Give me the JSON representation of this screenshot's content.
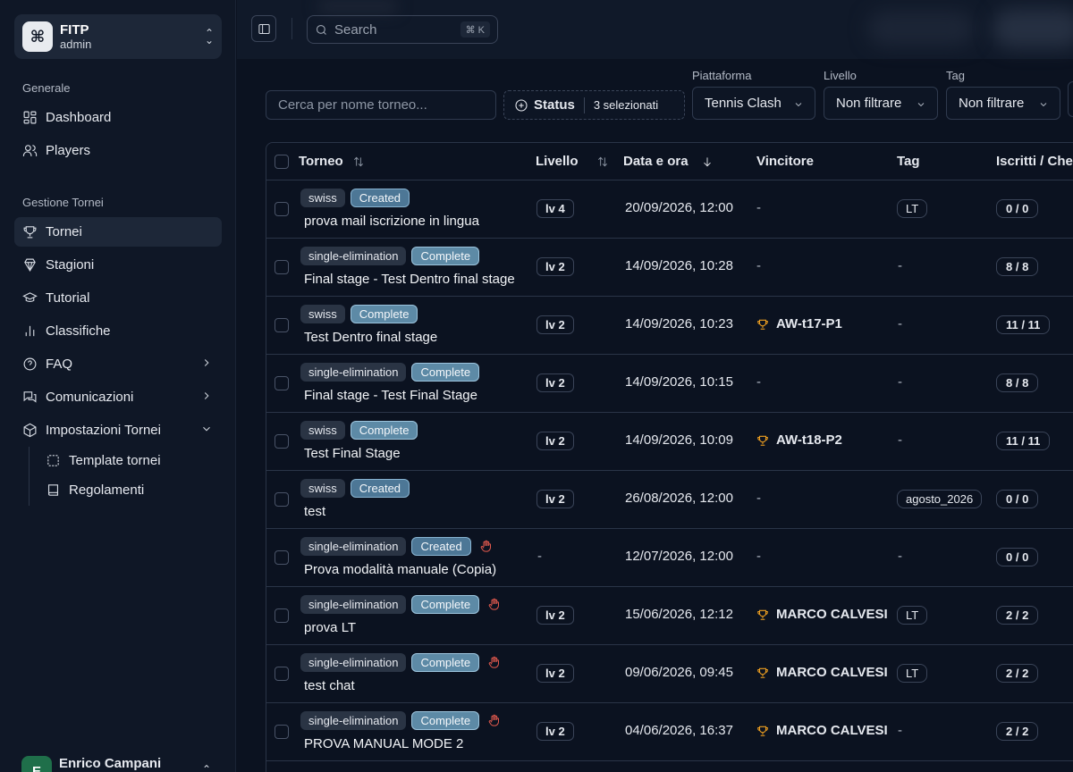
{
  "team": {
    "name": "FITP",
    "role": "admin",
    "logo_icon": "command-icon"
  },
  "sidebar": {
    "section_general": "Generale",
    "section_management": "Gestione Tornei",
    "items": [
      {
        "label": "Dashboard",
        "icon": "dashboard-icon"
      },
      {
        "label": "Players",
        "icon": "users-icon"
      },
      {
        "label": "Tornei",
        "icon": "trophy-icon",
        "active": true
      },
      {
        "label": "Stagioni",
        "icon": "award-icon"
      },
      {
        "label": "Tutorial",
        "icon": "graduation-cap-icon"
      },
      {
        "label": "Classifiche",
        "icon": "bar-chart-icon"
      },
      {
        "label": "FAQ",
        "icon": "help-circle-icon"
      },
      {
        "label": "Comunicazioni",
        "icon": "messages-icon"
      },
      {
        "label": "Impostazioni Tornei",
        "icon": "package-icon"
      }
    ],
    "subitems": [
      {
        "label": "Template tornei",
        "icon": "dashed-square-icon"
      },
      {
        "label": "Regolamenti",
        "icon": "book-icon"
      }
    ]
  },
  "user": {
    "initial": "E",
    "name": "Enrico Campani"
  },
  "topbar": {
    "search_placeholder": "Search",
    "search_shortcut": "⌘ K"
  },
  "filters": {
    "name_placeholder": "Cerca per nome torneo...",
    "status_label": "Status",
    "status_count": "3 selezionati",
    "platform_label": "Piattaforma",
    "platform_value": "Tennis Clash",
    "level_label": "Livello",
    "level_value": "Non filtrare",
    "tag_label": "Tag",
    "tag_value": "Non filtrare"
  },
  "table": {
    "columns": {
      "torneo": "Torneo",
      "livello": "Livello",
      "data": "Data e ora",
      "vincitore": "Vincitore",
      "tag": "Tag",
      "iscritti": "Iscritti / Check-in"
    },
    "rows": [
      {
        "type": "swiss",
        "status": "Created",
        "manual": false,
        "name": "prova mail iscrizione in lingua",
        "level": "lv 4",
        "date": "20/09/2026, 12:00",
        "winner": "-",
        "tag": "LT",
        "iscritti": "0 / 0"
      },
      {
        "type": "single-elimination",
        "status": "Complete",
        "manual": false,
        "name": "Final stage - Test Dentro final stage",
        "level": "lv 2",
        "date": "14/09/2026, 10:28",
        "winner": "-",
        "tag": "-",
        "iscritti": "8 / 8"
      },
      {
        "type": "swiss",
        "status": "Complete",
        "manual": false,
        "name": "Test Dentro final stage",
        "level": "lv 2",
        "date": "14/09/2026, 10:23",
        "winner": "AW-t17-P1",
        "tag": "-",
        "iscritti": "11 / 11"
      },
      {
        "type": "single-elimination",
        "status": "Complete",
        "manual": false,
        "name": "Final stage - Test Final Stage",
        "level": "lv 2",
        "date": "14/09/2026, 10:15",
        "winner": "-",
        "tag": "-",
        "iscritti": "8 / 8"
      },
      {
        "type": "swiss",
        "status": "Complete",
        "manual": false,
        "name": "Test Final Stage",
        "level": "lv 2",
        "date": "14/09/2026, 10:09",
        "winner": "AW-t18-P2",
        "tag": "-",
        "iscritti": "11 / 11"
      },
      {
        "type": "swiss",
        "status": "Created",
        "manual": false,
        "name": "test",
        "level": "lv 2",
        "date": "26/08/2026, 12:00",
        "winner": "-",
        "tag": "agosto_2026",
        "iscritti": "0 / 0"
      },
      {
        "type": "single-elimination",
        "status": "Created",
        "manual": true,
        "name": "Prova modalità manuale (Copia)",
        "level": "-",
        "date": "12/07/2026, 12:00",
        "winner": "-",
        "tag": "-",
        "iscritti": "0 / 0"
      },
      {
        "type": "single-elimination",
        "status": "Complete",
        "manual": true,
        "name": "prova LT",
        "level": "lv 2",
        "date": "15/06/2026, 12:12",
        "winner": "MARCO CALVESI",
        "tag": "LT",
        "iscritti": "2 / 2"
      },
      {
        "type": "single-elimination",
        "status": "Complete",
        "manual": true,
        "name": "test chat",
        "level": "lv 2",
        "date": "09/06/2026, 09:45",
        "winner": "MARCO CALVESI",
        "tag": "LT",
        "iscritti": "2 / 2"
      },
      {
        "type": "single-elimination",
        "status": "Complete",
        "manual": true,
        "name": "PROVA MANUAL MODE 2",
        "level": "lv 2",
        "date": "04/06/2026, 16:37",
        "winner": "MARCO CALVESI",
        "tag": "-",
        "iscritti": "2 / 2"
      }
    ]
  },
  "colors": {
    "background": "#0b1220",
    "sidebar": "#0f1726",
    "created_badge": "#4d7796",
    "complete_badge": "#5d8aa6",
    "trophy": "#f0a020",
    "manual_icon": "#e55a4e"
  }
}
